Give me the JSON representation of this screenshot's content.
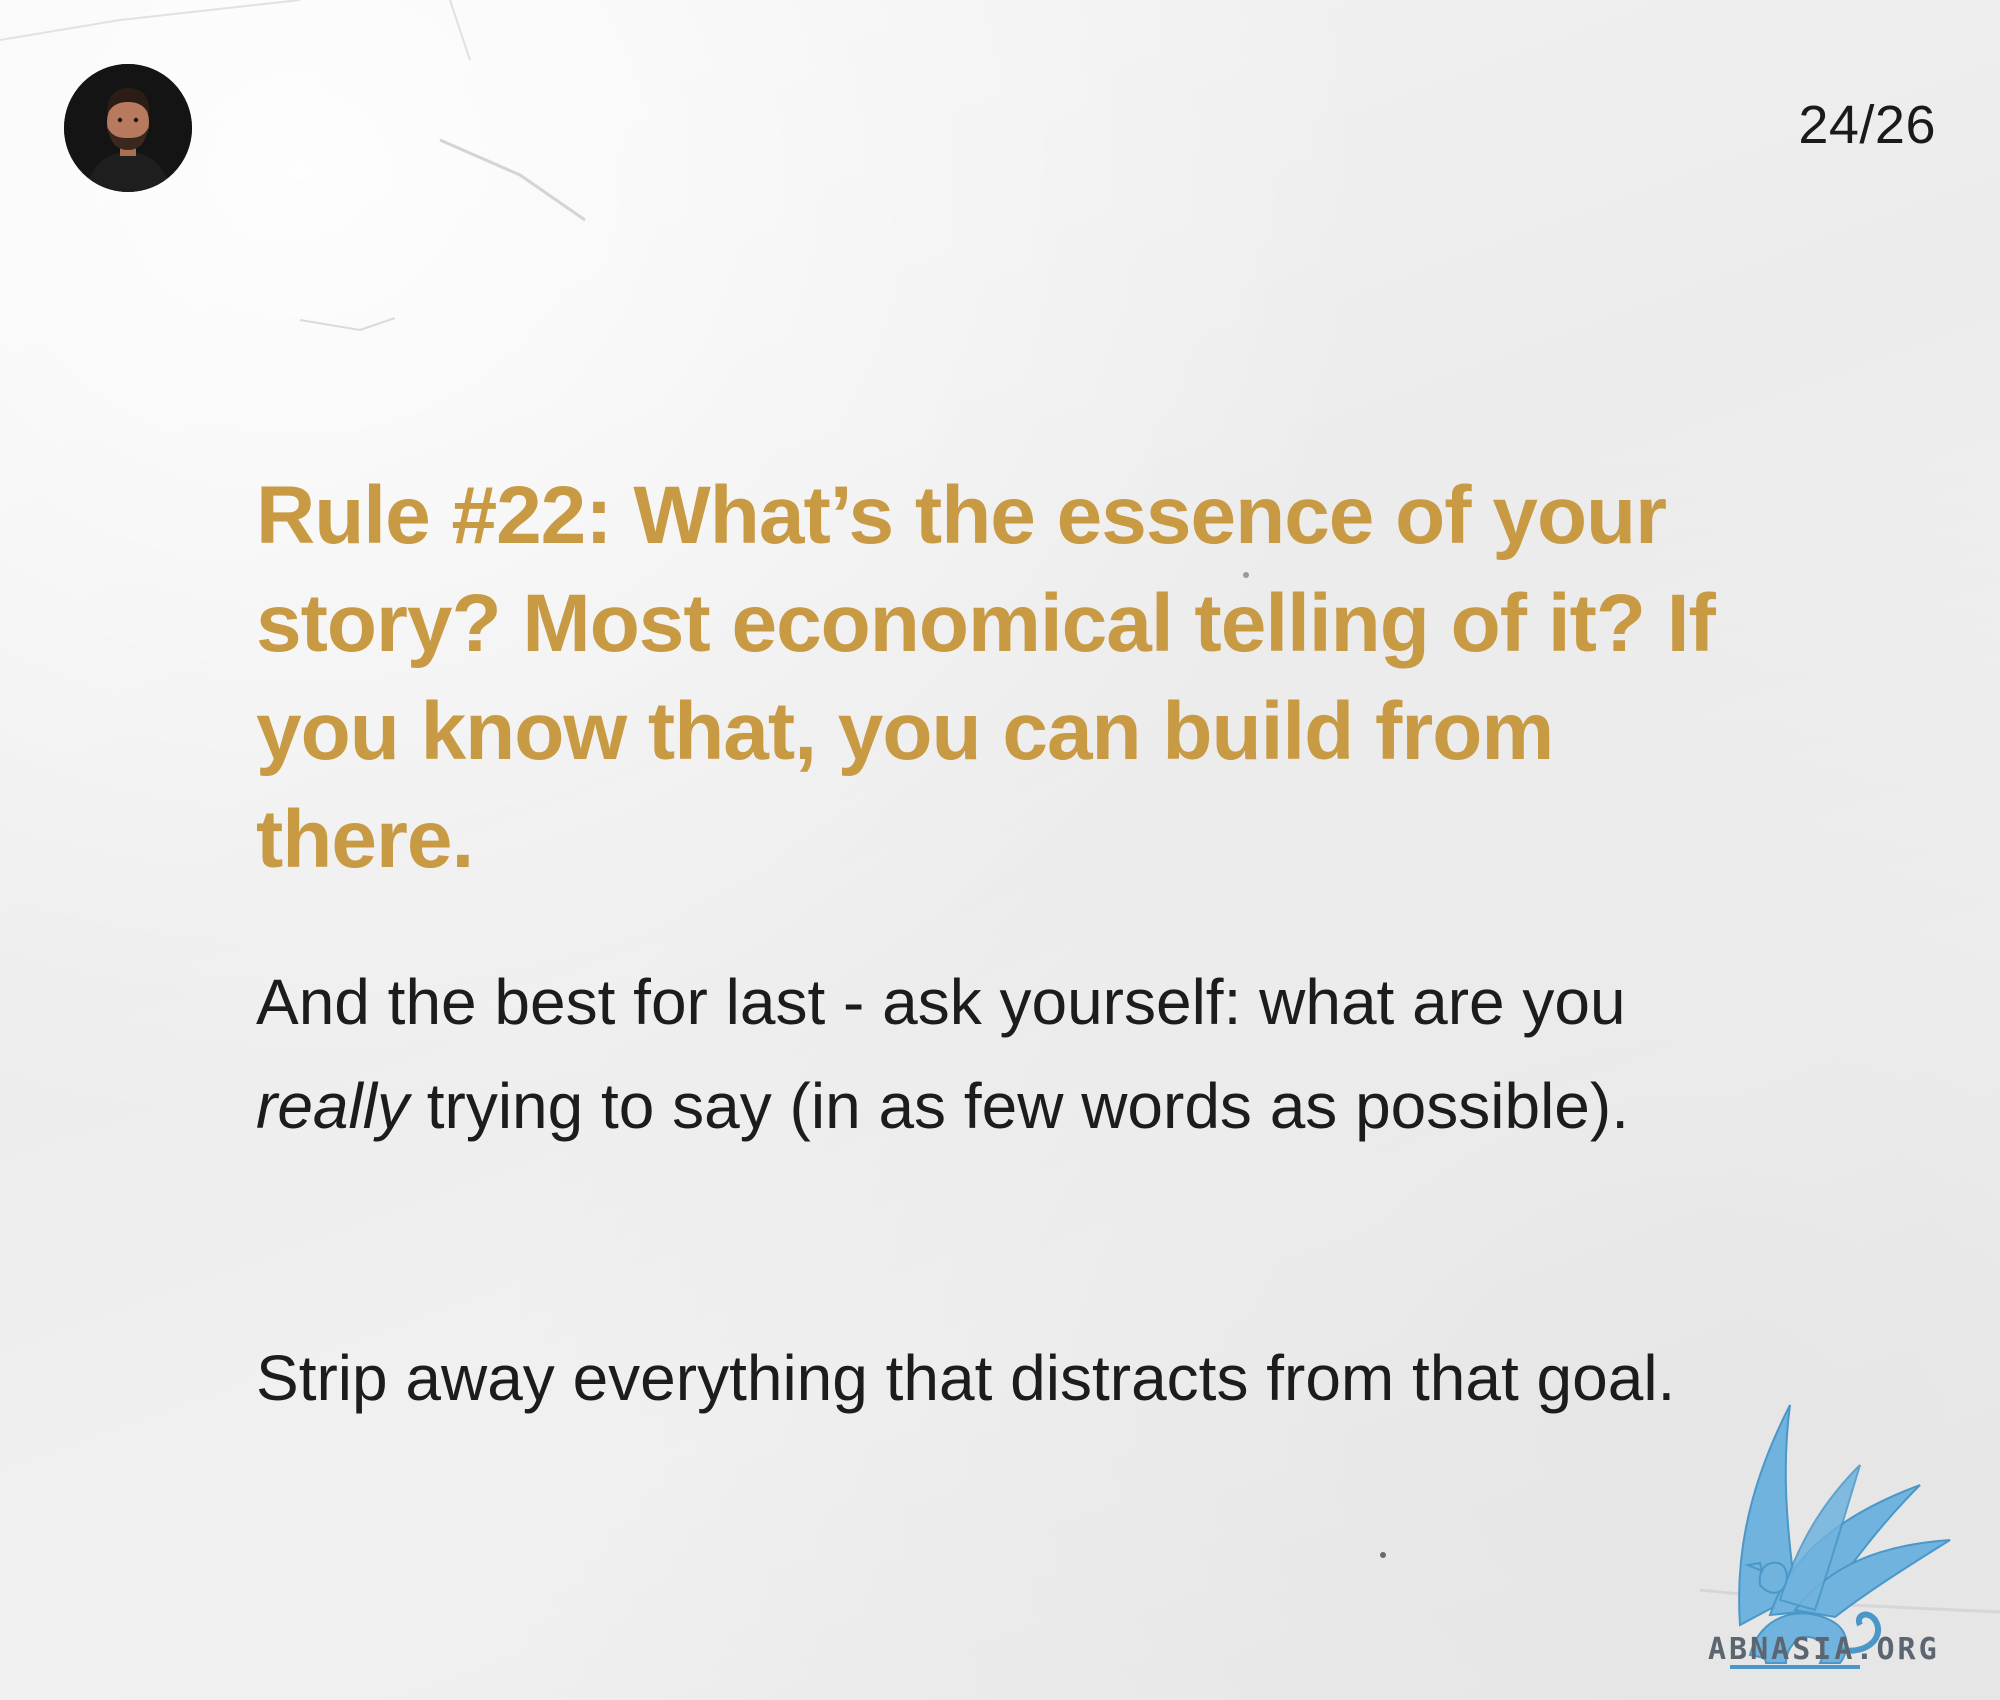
{
  "header": {
    "page_counter": "24/26",
    "avatar_icon": "person-portrait-icon"
  },
  "content": {
    "heading": "Rule #22: What’s the essence of your story? Most economical telling of it? If you know that, you can build from there.",
    "paragraph_1": {
      "before": "And the best for last - ask yourself: what are you ",
      "emphasis": "really",
      "after": " trying to say (in as few words as possible)."
    },
    "paragraph_2": "Strip away everything that distracts from that goal."
  },
  "watermark": {
    "icon": "griffin-logo-icon",
    "text": "ABNASIA.ORG"
  },
  "colors": {
    "heading": "#c99a44",
    "body_text": "#1c1c1c",
    "background": "#eeeeee",
    "watermark_blue": "#6fb3de"
  }
}
